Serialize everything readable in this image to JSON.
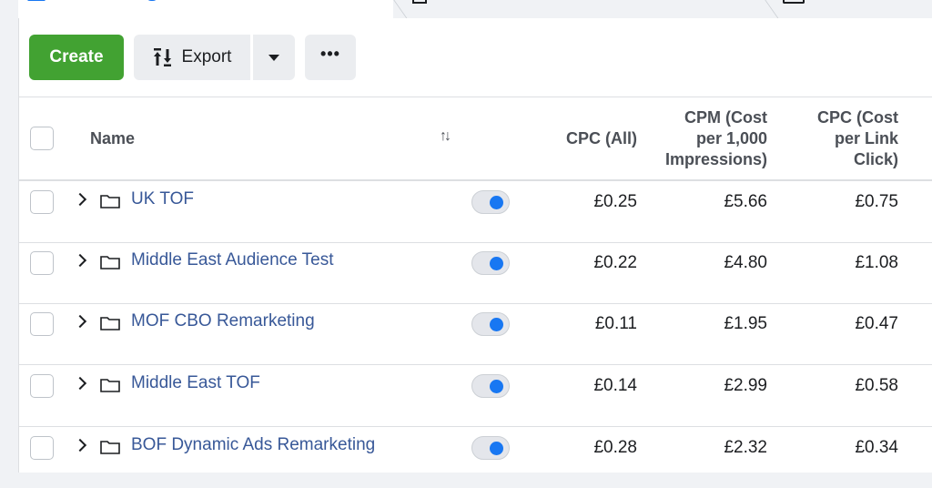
{
  "toolbar": {
    "create_label": "Create",
    "export_label": "Export"
  },
  "table": {
    "headers": {
      "name": "Name",
      "cpc_all": "CPC (All)",
      "cpm": [
        "CPM (Cost",
        "per 1,000",
        "Impressions)"
      ],
      "cpc_link": [
        "CPC (Cost",
        "per Link",
        "Click)"
      ]
    },
    "rows": [
      {
        "name": "UK TOF",
        "cpc_all": "£0.25",
        "cpm": "£5.66",
        "cpc_link": "£0.75",
        "on": true
      },
      {
        "name": "Middle East Audience Test",
        "cpc_all": "£0.22",
        "cpm": "£4.80",
        "cpc_link": "£1.08",
        "on": true
      },
      {
        "name": "MOF CBO Remarketing",
        "cpc_all": "£0.11",
        "cpm": "£1.95",
        "cpc_link": "£0.47",
        "on": true
      },
      {
        "name": "Middle East TOF",
        "cpc_all": "£0.14",
        "cpm": "£2.99",
        "cpc_link": "£0.58",
        "on": true
      },
      {
        "name": "BOF Dynamic Ads Remarketing",
        "cpc_all": "£0.28",
        "cpm": "£2.32",
        "cpc_link": "£0.34",
        "on": true
      }
    ]
  },
  "colors": {
    "create_green": "#42a232",
    "link_blue": "#385898",
    "toggle_blue": "#1877f2"
  },
  "icons": {
    "export": "export-arrows-icon",
    "caret": "caret-down-icon",
    "more": "more-horizontal-icon",
    "sort": "sort-icon",
    "expand": "chevron-right-icon",
    "folder": "folder-icon"
  }
}
